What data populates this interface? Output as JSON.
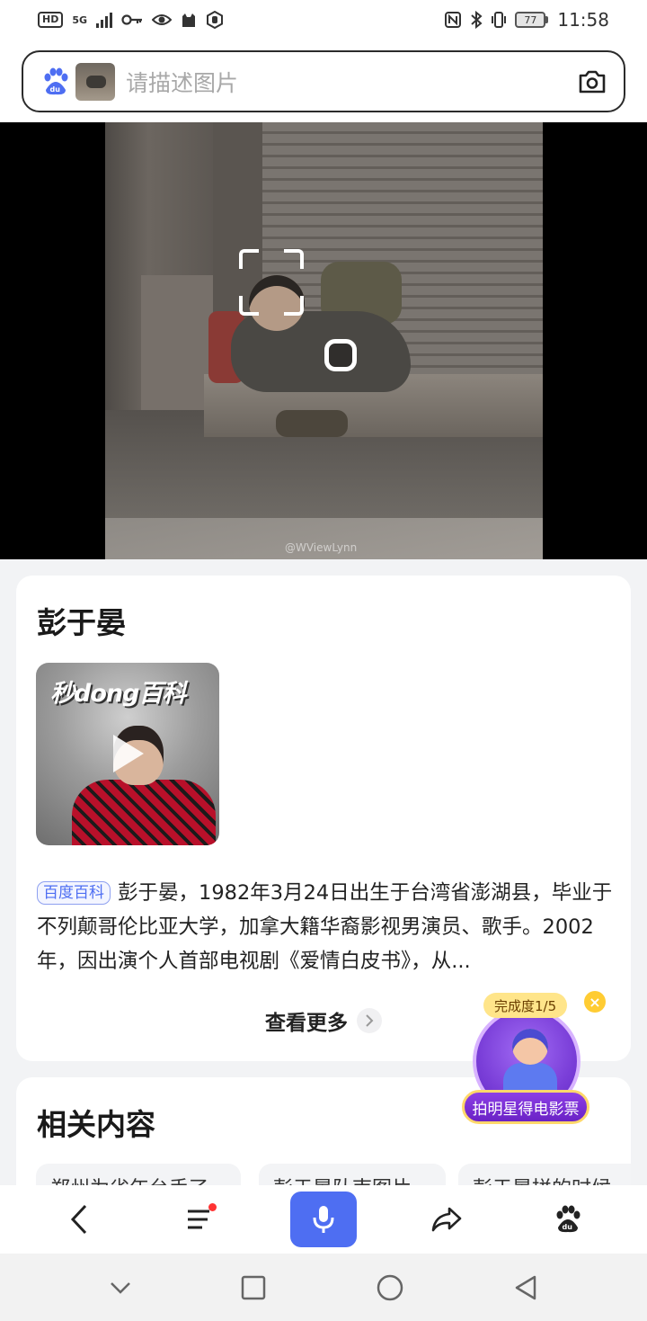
{
  "status_bar": {
    "hd": "HD",
    "network": "5G",
    "battery": "77",
    "time": "11:58"
  },
  "search": {
    "placeholder": "请描述图片",
    "logo_icon": "baidu-paw-icon",
    "camera_icon": "camera-icon"
  },
  "photo": {
    "watermark": "@WViewLynn"
  },
  "result": {
    "title": "彭于晏",
    "video_logo": "秒dong百科",
    "source_tag": "百度百科",
    "description": "彭于晏，1982年3月24日出生于台湾省澎湖县，毕业于不列颠哥伦比亚大学，加拿大籍华裔影视男演员、歌手。2002年，因出演个人首部电视剧《爱情白皮书》，从...",
    "see_more": "查看更多"
  },
  "related": {
    "title": "相关内容",
    "chips": [
      "郑州为省年台手了",
      "彭于晏队南图片",
      "彭于晏拼的时候"
    ]
  },
  "float_badge": {
    "progress": "完成度1/5",
    "label": "拍明星得电影票"
  },
  "toolbar": {
    "items": [
      "back-icon",
      "menu-icon",
      "mic-icon",
      "share-icon",
      "baidu-home-icon"
    ]
  },
  "colors": {
    "accent": "#4e6ef2",
    "badge_purple": "#7a3ed8",
    "badge_gold": "#ffd86b"
  }
}
